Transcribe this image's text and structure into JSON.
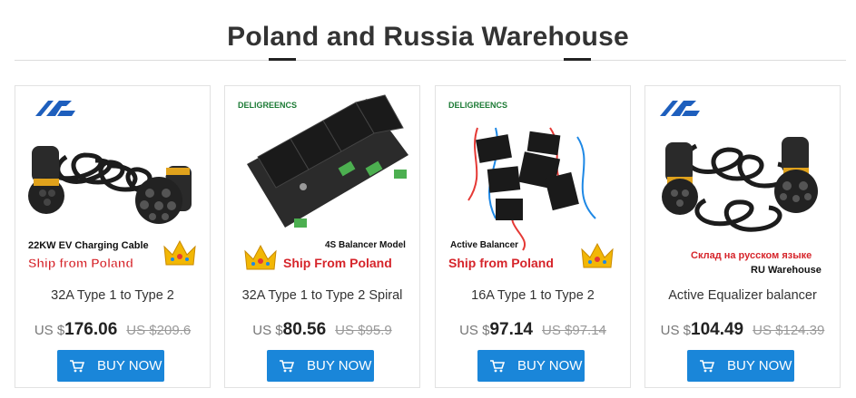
{
  "header": {
    "title": "Poland and Russia Warehouse"
  },
  "button_label": "BUY NOW",
  "colors": {
    "accent": "#1a86d9",
    "promo_red": "#d6252b",
    "crown_gold": "#f2b705"
  },
  "products": [
    {
      "name": "32A Type 1 to Type 2",
      "currency": "US $",
      "price": "176.06",
      "old_price": "US $209.6",
      "image": {
        "brand_logo": "AG",
        "caption": "22KW EV Charging Cable",
        "promo": "Ship from Poland",
        "icons": [
          "crown-icon"
        ]
      }
    },
    {
      "name": "32A Type 1 to Type 2 Spiral",
      "currency": "US $",
      "price": "80.56",
      "old_price": "US $95.9",
      "image": {
        "brand_logo": "DELIGREENCS",
        "caption": "4S Balancer Model",
        "promo": "Ship From Poland",
        "icons": [
          "crown-icon"
        ]
      }
    },
    {
      "name": "16A Type 1 to Type 2",
      "currency": "US $",
      "price": "97.14",
      "old_price": "US $97.14",
      "image": {
        "brand_logo": "DELIGREENCS",
        "caption": "Active Balancer",
        "promo": "Ship from Poland",
        "icons": [
          "crown-icon"
        ]
      }
    },
    {
      "name": "Active Equalizer balancer",
      "currency": "US $",
      "price": "104.49",
      "old_price": "US $124.39",
      "image": {
        "brand_logo": "AG",
        "caption": "Склад на русском языке",
        "promo": "RU Warehouse",
        "icons": []
      }
    }
  ]
}
